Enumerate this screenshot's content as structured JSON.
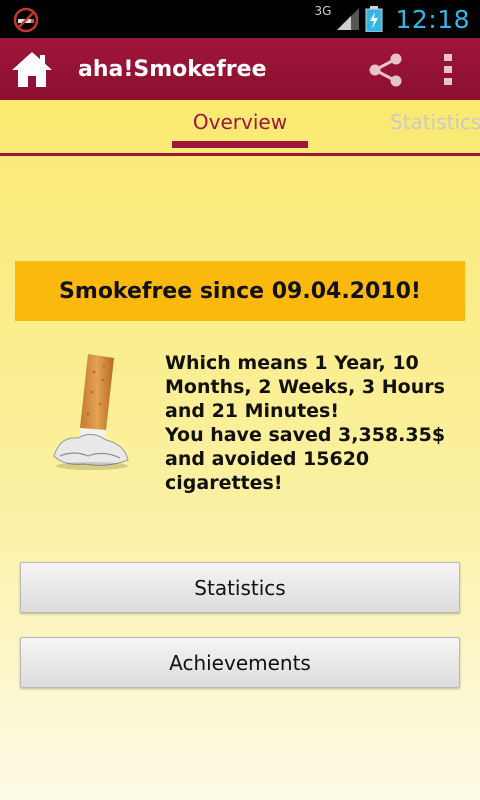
{
  "status_bar": {
    "network_type": "3G",
    "time": "12:18",
    "notification_icon": "no-smoking-icon",
    "accent_color": "#33b5e5"
  },
  "action_bar": {
    "title": "aha!Smokefree",
    "home_icon": "home-icon",
    "share_icon": "share-icon",
    "overflow_icon": "overflow-menu-icon",
    "color": "#a0163a"
  },
  "tabs": [
    {
      "label": "Overview",
      "selected": true
    },
    {
      "label": "Statistics",
      "selected": false
    }
  ],
  "overview": {
    "since_text": "Smokefree since 09.04.2010!",
    "summary_line1": "Which means 1 Year, 10 Months, 2 Weeks, 3 Hours and 21 Minutes!",
    "summary_line2": "You have saved 3,358.35$ and avoided 15620 cigarettes!",
    "image_icon": "cigarette-butt-icon"
  },
  "buttons": {
    "statistics": "Statistics",
    "achievements": "Achievements"
  }
}
